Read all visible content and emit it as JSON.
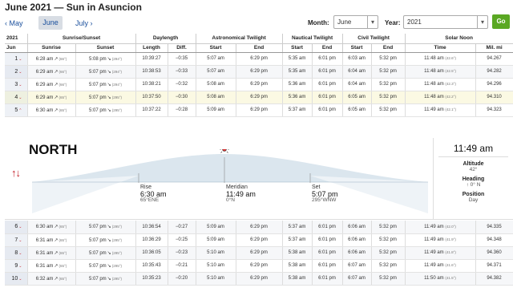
{
  "page": {
    "title": "June 2021 — Sun in Asuncion"
  },
  "nav": {
    "prev": "‹ May",
    "current": "June",
    "next": "July ›"
  },
  "selectors": {
    "month_label": "Month:",
    "month_value": "June",
    "year_label": "Year:",
    "year_value": "2021",
    "go_label": "Go"
  },
  "table": {
    "header_top": {
      "year": "2021",
      "sunrise_sunset": "Sunrise/Sunset",
      "daylength": "Daylength",
      "astro": "Astronomical Twilight",
      "nautical": "Nautical Twilight",
      "civil": "Civil Twilight",
      "noon": "Solar Noon"
    },
    "header_bottom": {
      "month": "Jun",
      "sunrise": "Sunrise",
      "sunset": "Sunset",
      "length": "Length",
      "diff": "Diff.",
      "astro_start": "Start",
      "astro_end": "End",
      "naut_start": "Start",
      "naut_end": "End",
      "civil_start": "Start",
      "civil_end": "End",
      "noon_time": "Time",
      "mil_mi": "Mil. mi"
    },
    "rows_top": [
      {
        "day": "1",
        "sunrise": "6:28 am",
        "sunrise_az": "(66°)",
        "sunset": "5:08 pm",
        "sunset_az": "(294°)",
        "length": "10:39:27",
        "diff": "−0:35",
        "astro_start": "5:07 am",
        "astro_end": "6:29 pm",
        "naut_start": "5:35 am",
        "naut_end": "6:01 pm",
        "civil_start": "6:03 am",
        "civil_end": "5:32 pm",
        "noon": "11:48 am",
        "noon_alt": "(42.6°)",
        "dist": "94.267"
      },
      {
        "day": "2",
        "sunrise": "6:29 am",
        "sunrise_az": "(66°)",
        "sunset": "5:07 pm",
        "sunset_az": "(294°)",
        "length": "10:38:53",
        "diff": "−0:33",
        "astro_start": "5:07 am",
        "astro_end": "6:29 pm",
        "naut_start": "5:35 am",
        "naut_end": "6:01 pm",
        "civil_start": "6:04 am",
        "civil_end": "5:32 pm",
        "noon": "11:48 am",
        "noon_alt": "(42.5°)",
        "dist": "94.282"
      },
      {
        "day": "3",
        "sunrise": "6:29 am",
        "sunrise_az": "(66°)",
        "sunset": "5:07 pm",
        "sunset_az": "(294°)",
        "length": "10:38:21",
        "diff": "−0:32",
        "astro_start": "5:08 am",
        "astro_end": "6:29 pm",
        "naut_start": "5:36 am",
        "naut_end": "6:01 pm",
        "civil_start": "6:04 am",
        "civil_end": "5:32 pm",
        "noon": "11:48 am",
        "noon_alt": "(42.3°)",
        "dist": "94.296"
      },
      {
        "day": "4",
        "sunrise": "6:29 am",
        "sunrise_az": "(65°)",
        "sunset": "5:07 pm",
        "sunset_az": "(295°)",
        "length": "10:37:50",
        "diff": "−0:30",
        "astro_start": "5:08 am",
        "astro_end": "6:29 pm",
        "naut_start": "5:36 am",
        "naut_end": "6:01 pm",
        "civil_start": "6:05 am",
        "civil_end": "5:32 pm",
        "noon": "11:48 am",
        "noon_alt": "(42.2°)",
        "dist": "94.310"
      },
      {
        "day": "5",
        "sunrise": "6:30 am",
        "sunrise_az": "(65°)",
        "sunset": "5:07 pm",
        "sunset_az": "(295°)",
        "length": "10:37:22",
        "diff": "−0:28",
        "astro_start": "5:09 am",
        "astro_end": "6:29 pm",
        "naut_start": "5:37 am",
        "naut_end": "6:01 pm",
        "civil_start": "6:05 am",
        "civil_end": "5:32 pm",
        "noon": "11:49 am",
        "noon_alt": "(42.1°)",
        "dist": "94.323"
      }
    ],
    "rows_bottom": [
      {
        "day": "6",
        "sunrise": "6:30 am",
        "sunrise_az": "(65°)",
        "sunset": "5:07 pm",
        "sunset_az": "(295°)",
        "length": "10:36:54",
        "diff": "−0:27",
        "astro_start": "5:09 am",
        "astro_end": "6:29 pm",
        "naut_start": "5:37 am",
        "naut_end": "6:01 pm",
        "civil_start": "6:06 am",
        "civil_end": "5:32 pm",
        "noon": "11:49 am",
        "noon_alt": "(42.0°)",
        "dist": "94.335"
      },
      {
        "day": "7",
        "sunrise": "6:31 am",
        "sunrise_az": "(65°)",
        "sunset": "5:07 pm",
        "sunset_az": "(295°)",
        "length": "10:36:29",
        "diff": "−0:25",
        "astro_start": "5:09 am",
        "astro_end": "6:29 pm",
        "naut_start": "5:37 am",
        "naut_end": "6:01 pm",
        "civil_start": "6:06 am",
        "civil_end": "5:32 pm",
        "noon": "11:49 am",
        "noon_alt": "(41.9°)",
        "dist": "94.348"
      },
      {
        "day": "8",
        "sunrise": "6:31 am",
        "sunrise_az": "(65°)",
        "sunset": "5:07 pm",
        "sunset_az": "(295°)",
        "length": "10:36:05",
        "diff": "−0:23",
        "astro_start": "5:10 am",
        "astro_end": "6:29 pm",
        "naut_start": "5:38 am",
        "naut_end": "6:01 pm",
        "civil_start": "6:06 am",
        "civil_end": "5:32 pm",
        "noon": "11:49 am",
        "noon_alt": "(41.8°)",
        "dist": "94.360"
      },
      {
        "day": "9",
        "sunrise": "6:31 am",
        "sunrise_az": "(65°)",
        "sunset": "5:07 pm",
        "sunset_az": "(295°)",
        "length": "10:35:43",
        "diff": "−0:21",
        "astro_start": "5:10 am",
        "astro_end": "6:29 pm",
        "naut_start": "5:38 am",
        "naut_end": "6:01 pm",
        "civil_start": "6:07 am",
        "civil_end": "5:32 pm",
        "noon": "11:49 am",
        "noon_alt": "(41.6°)",
        "dist": "94.371"
      },
      {
        "day": "10",
        "sunrise": "6:32 am",
        "sunrise_az": "(65°)",
        "sunset": "5:07 pm",
        "sunset_az": "(295°)",
        "length": "10:35:23",
        "diff": "−0:20",
        "astro_start": "5:10 am",
        "astro_end": "6:29 pm",
        "naut_start": "5:38 am",
        "naut_end": "6:01 pm",
        "civil_start": "6:07 am",
        "civil_end": "5:32 pm",
        "noon": "11:50 am",
        "noon_alt": "(41.5°)",
        "dist": "94.382"
      }
    ]
  },
  "sun_panel": {
    "direction_label": "NORTH",
    "direction_arrows": "↑↓",
    "rise_label": "Rise",
    "rise_time": "6:30 am",
    "rise_dir": "65°ENE",
    "meridian_label": "Meridian",
    "meridian_time": "11:49 am",
    "meridian_dir": "0°N",
    "set_label": "Set",
    "set_time": "5:07 pm",
    "set_dir": "295°WNW",
    "info_time": "11:49 am",
    "altitude_label": "Altitude",
    "altitude_value": "42°",
    "heading_label": "Heading",
    "heading_arrow": "↑",
    "heading_value": "0°",
    "heading_dir": "N",
    "position_label": "Position",
    "position_value": "Day"
  },
  "colors": {
    "accent_link": "#1a4f9c",
    "go_green": "#5aa823",
    "chevron_red": "#c4202a",
    "arc_fill": "#dbe6ee",
    "today_row": "#fbf9e3"
  },
  "icons": {
    "row_chevron": "chevron-down-icon",
    "sunrise_arrow": "sunrise-arrow-icon",
    "sunset_arrow": "sunset-arrow-icon",
    "sun": "sun-icon"
  }
}
